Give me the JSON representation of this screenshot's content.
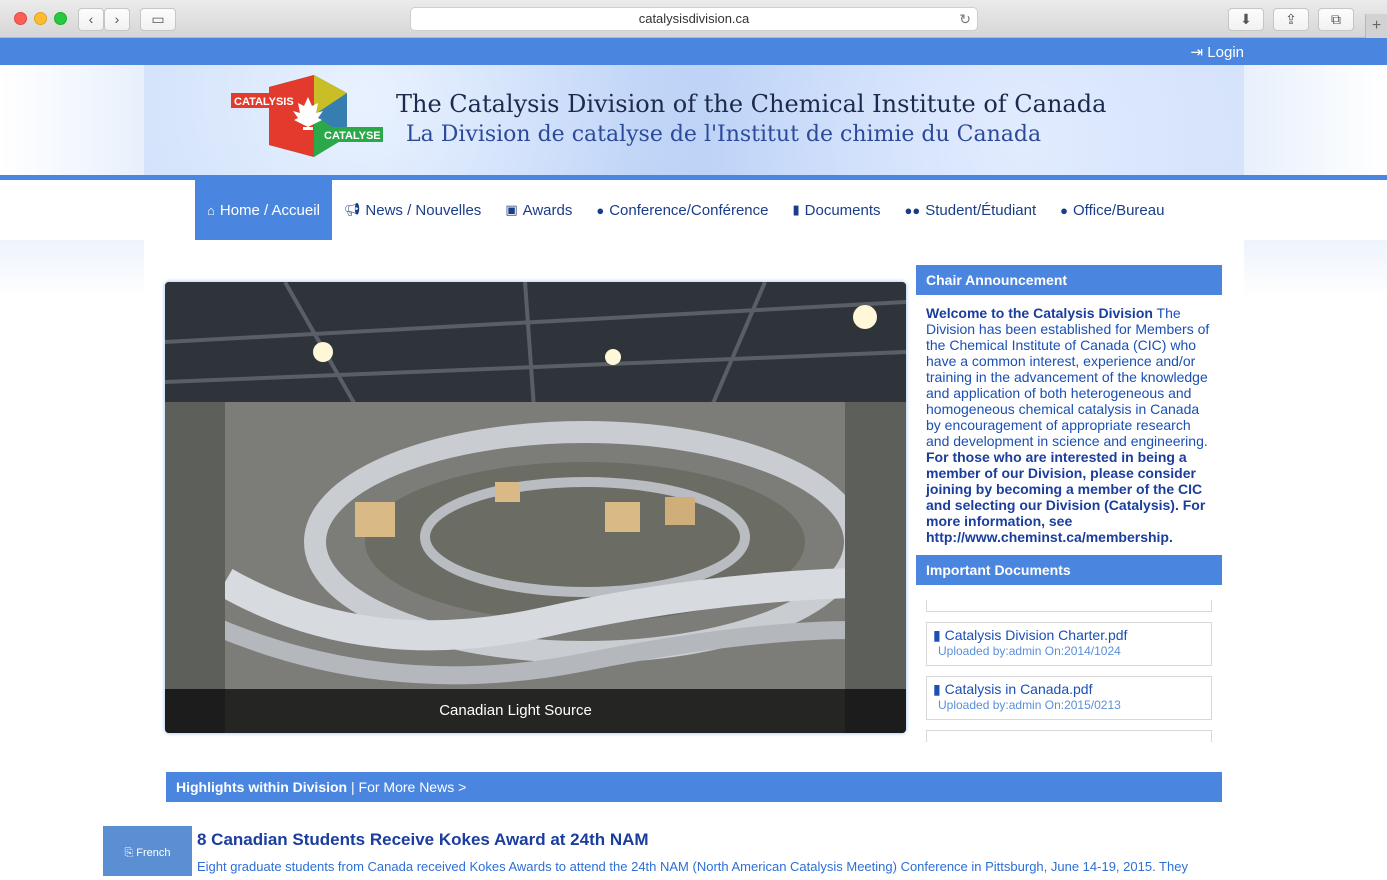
{
  "browser": {
    "url": "catalysisdivision.ca"
  },
  "topbar": {
    "login_label": "Login"
  },
  "banner": {
    "logo_left": "CATALYSIS",
    "logo_right": "CATALYSE",
    "title_en": "The Catalysis Division of the Chemical Institute of Canada",
    "title_fr": "La Division de catalyse de l'Institut de chimie du Canada"
  },
  "nav": {
    "items": [
      {
        "label": "Home / Accueil",
        "icon": "home-icon"
      },
      {
        "label": "News / Nouvelles",
        "icon": "bullhorn-icon"
      },
      {
        "label": "Awards",
        "icon": "gift-icon"
      },
      {
        "label": "Conference/Conférence",
        "icon": "comments-icon"
      },
      {
        "label": "Documents",
        "icon": "file-icon"
      },
      {
        "label": "Student/Étudiant",
        "icon": "users-icon"
      },
      {
        "label": "Office/Bureau",
        "icon": "user-icon"
      }
    ]
  },
  "slider": {
    "caption": "Canadian Light Source"
  },
  "chair": {
    "heading": "Chair Announcement",
    "lead": "Welcome to the Catalysis Division",
    "body": " The Division has been established for Members of the Chemical Institute of Canada (CIC) who have a common interest, experience and/or training in the advancement of the knowledge and application of both heterogeneous and homogeneous chemical catalysis in Canada by encouragement of appropriate research and development in science and engineering. ",
    "closing": "For those who are interested in being a member of our Division, please consider joining by becoming a member of the CIC and selecting our Division (Catalysis). For more information, see http://www.cheminst.ca/membership."
  },
  "documents": {
    "heading": "Important Documents",
    "items": [
      {
        "title": "Catalysis Division Charter.pdf",
        "meta": "Uploaded by:admin On:2014/1024"
      },
      {
        "title": "Catalysis in Canada.pdf",
        "meta": "Uploaded by:admin On:2015/0213"
      }
    ]
  },
  "highlights": {
    "heading": "Highlights within Division",
    "more": " | For More News >"
  },
  "news": {
    "title": "8 Canadian Students Receive Kokes Award at 24th NAM",
    "body": "Eight graduate students from Canada received Kokes Awards to attend the 24th NAM (North American Catalysis Meeting) Conference in Pittsburgh, June 14-19, 2015. They"
  },
  "language": {
    "label": "French"
  }
}
